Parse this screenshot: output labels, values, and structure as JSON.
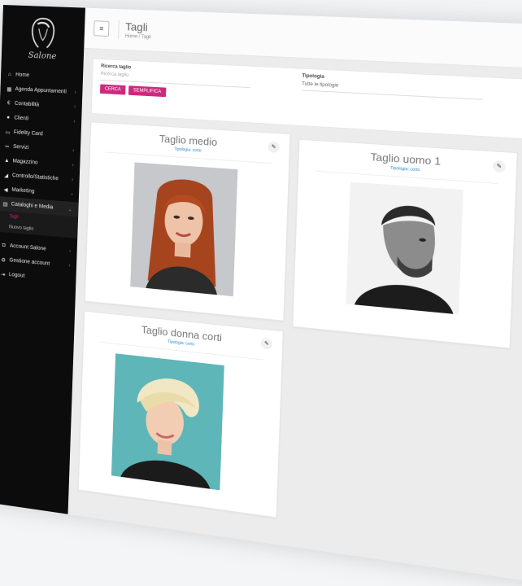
{
  "app": {
    "logo_text": "Salone"
  },
  "sidebar": {
    "items": [
      {
        "label": "Home",
        "icon": "home-icon"
      },
      {
        "label": "Agenda Appuntamenti",
        "icon": "calendar-icon",
        "chevron": true
      },
      {
        "label": "Contabilità",
        "icon": "money-icon",
        "chevron": true
      },
      {
        "label": "Clienti",
        "icon": "user-icon",
        "chevron": true
      },
      {
        "label": "Fidelity Card",
        "icon": "card-icon"
      },
      {
        "label": "Servizi",
        "icon": "scissors-icon",
        "chevron": true
      },
      {
        "label": "Magazzino",
        "icon": "box-icon",
        "chevron": true
      },
      {
        "label": "Controllo/Statistiche",
        "icon": "chart-icon",
        "chevron": true
      },
      {
        "label": "Marketing",
        "icon": "megaphone-icon",
        "chevron": true
      },
      {
        "label": "Cataloghi e Media",
        "icon": "catalog-icon",
        "chevron": true,
        "active": true
      }
    ],
    "subitems": [
      "Tagli",
      "Nuovo taglio"
    ],
    "bottom_items": [
      {
        "label": "Account Salone",
        "icon": "account-icon",
        "chevron": true
      },
      {
        "label": "Gestione account",
        "icon": "gear-icon",
        "chevron": true
      },
      {
        "label": "Logout",
        "icon": "logout-icon"
      }
    ]
  },
  "header": {
    "title": "Tagli",
    "breadcrumb": [
      "Home",
      "Tagli"
    ],
    "menu_icon": "menu-icon"
  },
  "filter": {
    "search_label": "Ricerca taglio",
    "search_placeholder": "Ricerca taglio",
    "search_button": "CERCA",
    "reset_button": "SEMPLIFICA",
    "type_label": "Tipologia",
    "type_value": "Tutte le tipologie"
  },
  "cards": [
    {
      "title": "Taglio medio",
      "subtitle": "Tipologia: corto",
      "photo": "red-hair-woman",
      "edit_icon": "pencil-icon"
    },
    {
      "title": "Taglio uomo 1",
      "subtitle": "Tipologia: corto",
      "photo": "man-short-hair",
      "edit_icon": "pencil-icon"
    },
    {
      "title": "Taglio donna corti",
      "subtitle": "Tipologia: corto",
      "photo": "blonde-pixie-woman",
      "edit_icon": "pencil-icon"
    }
  ],
  "colors": {
    "accent": "#cc2a7e",
    "sidebar_bg": "#0c0c0c",
    "link": "#1e88c9"
  }
}
